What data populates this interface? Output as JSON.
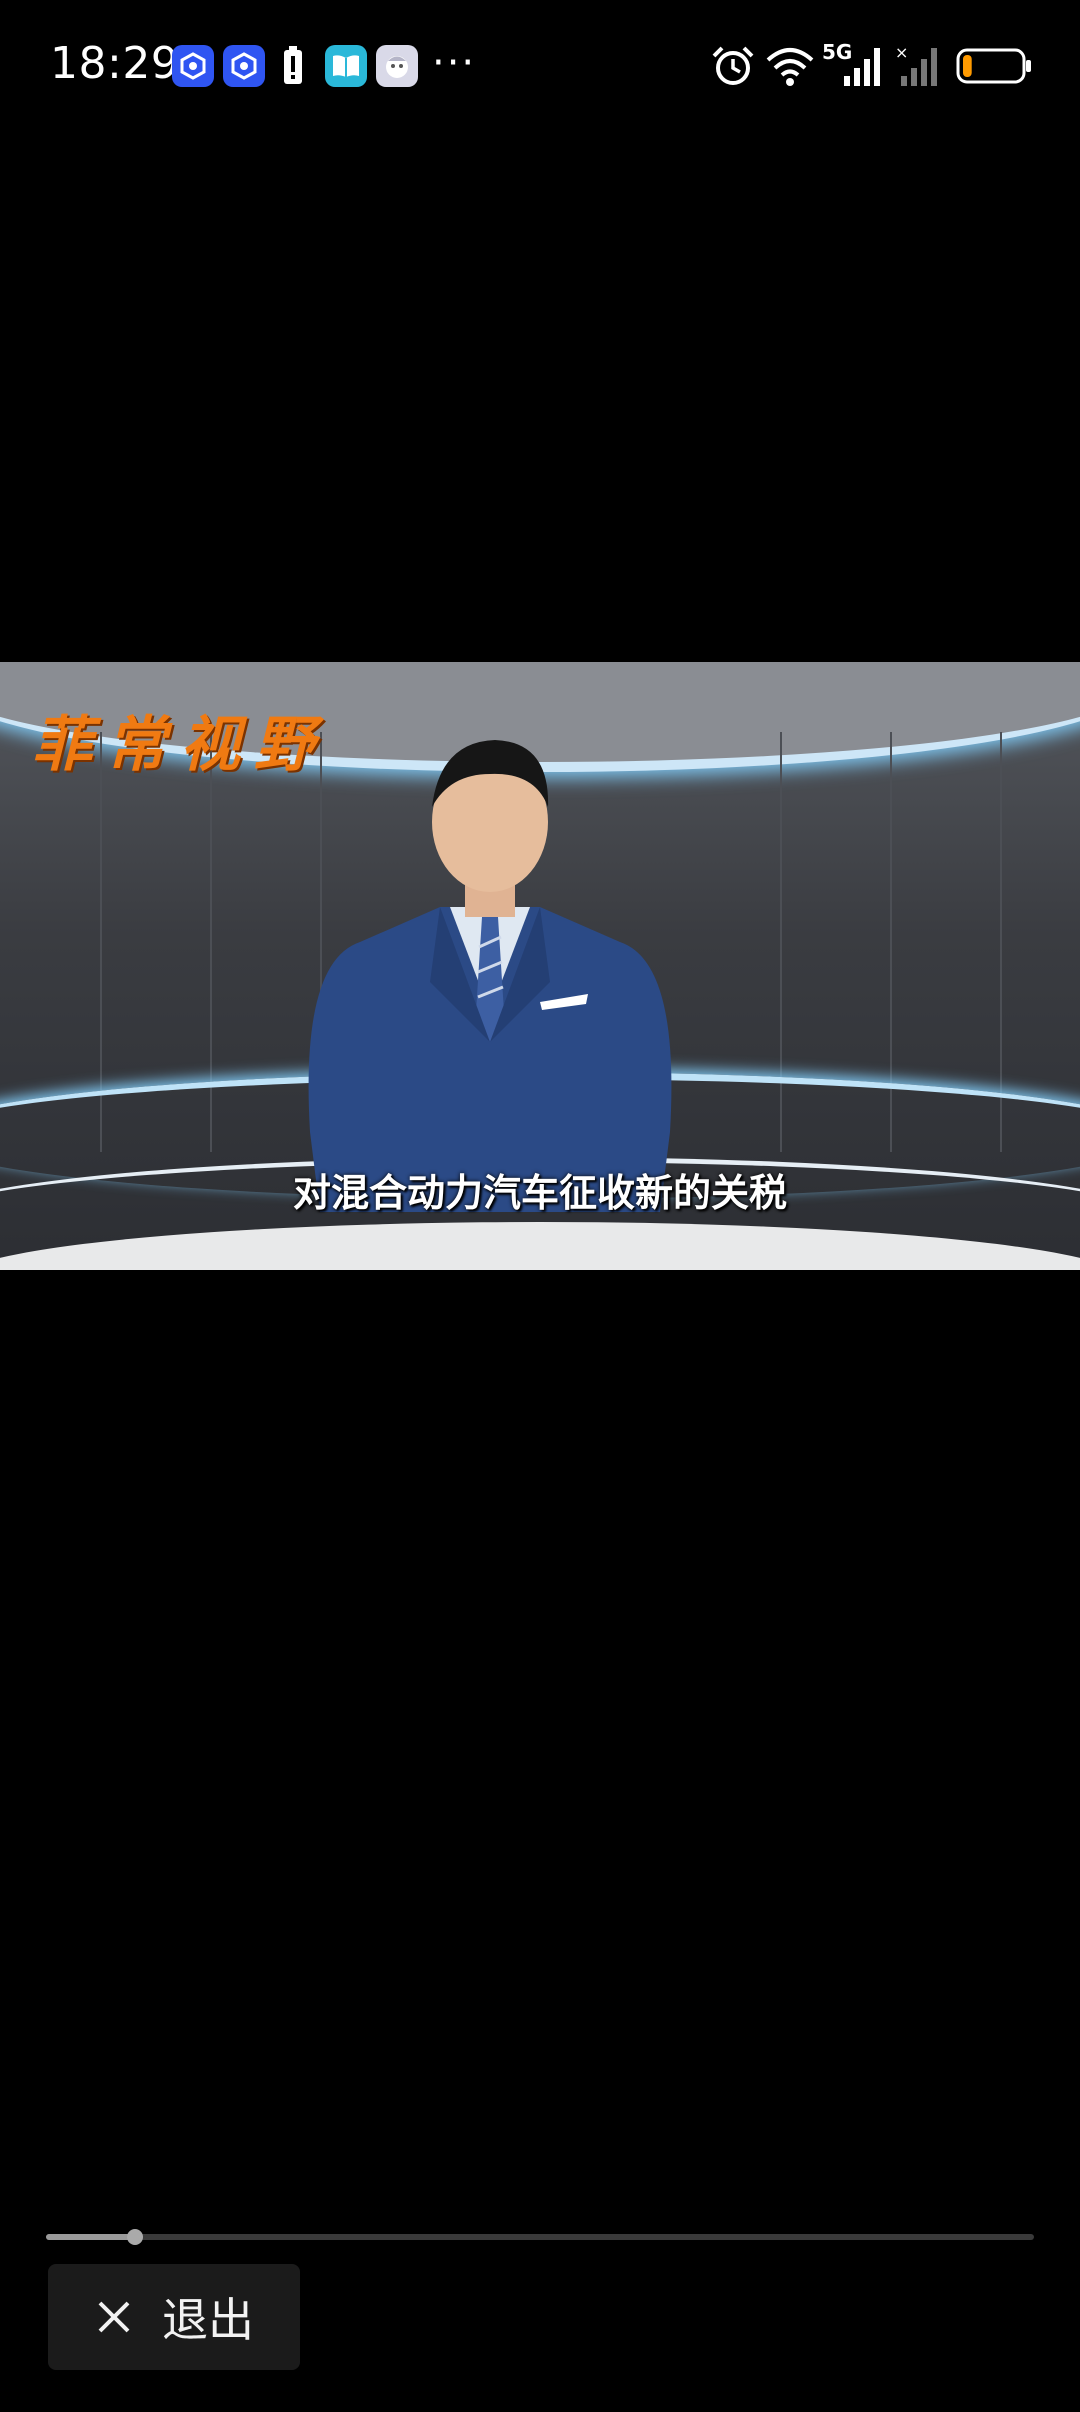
{
  "status_bar": {
    "time": "18:29",
    "network_label": "5G",
    "battery_level": 0.15,
    "battery_color": "#ff9a00"
  },
  "video": {
    "channel_logo": "菲常视野",
    "subtitle": "对混合动力汽车征收新的关税"
  },
  "player": {
    "progress": 0.09,
    "exit_label": "退出"
  },
  "icons": {
    "notifications": [
      "app-icon-blue",
      "app-icon-blue",
      "battery-alert-icon",
      "reader-app-icon",
      "avatar-app-icon",
      "more-icon"
    ],
    "status": [
      "alarm-icon",
      "wifi-icon",
      "cellular-signal-icon",
      "cellular-signal-icon",
      "battery-icon"
    ],
    "exit": "close-icon"
  }
}
